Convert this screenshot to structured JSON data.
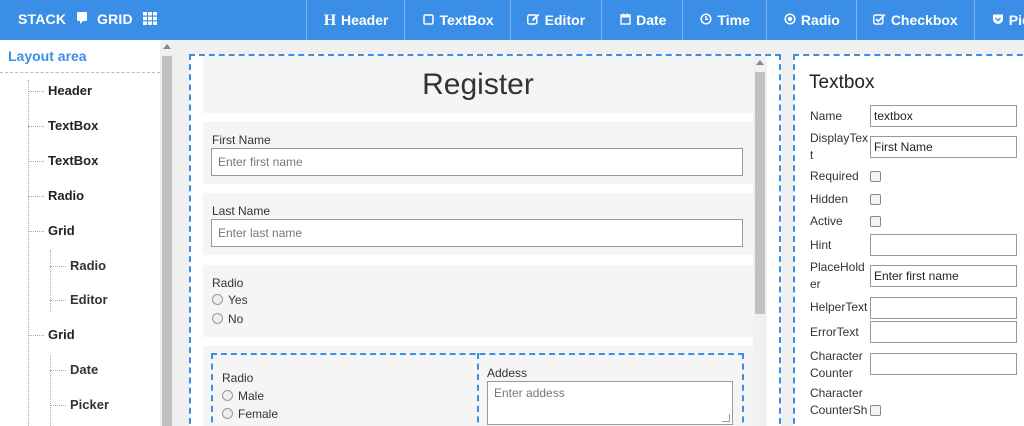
{
  "topbar": {
    "stack_label": "STACK",
    "grid_label": "GRID",
    "tabs": [
      {
        "label": "Header",
        "icon": "header-icon"
      },
      {
        "label": "TextBox",
        "icon": "square-icon"
      },
      {
        "label": "Editor",
        "icon": "edit-icon"
      },
      {
        "label": "Date",
        "icon": "calendar-icon"
      },
      {
        "label": "Time",
        "icon": "clock-icon"
      },
      {
        "label": "Radio",
        "icon": "radio-icon"
      },
      {
        "label": "Checkbox",
        "icon": "checkbox-icon"
      },
      {
        "label": "Picker",
        "icon": "picker-icon"
      }
    ],
    "color": "#3a8ee6"
  },
  "sidebar": {
    "title": "Layout area",
    "items": [
      {
        "label": "Header"
      },
      {
        "label": "TextBox"
      },
      {
        "label": "TextBox"
      },
      {
        "label": "Radio"
      },
      {
        "label": "Grid"
      },
      {
        "label": "Radio"
      },
      {
        "label": "Editor"
      },
      {
        "label": "Grid"
      },
      {
        "label": "Date"
      },
      {
        "label": "Picker"
      }
    ]
  },
  "form": {
    "title": "Register",
    "first_name": {
      "label": "First Name",
      "placeholder": "Enter first name"
    },
    "last_name": {
      "label": "Last Name",
      "placeholder": "Enter last name"
    },
    "radio": {
      "label": "Radio",
      "options": [
        "Yes",
        "No"
      ]
    },
    "grid": {
      "radio": {
        "label": "Radio",
        "options": [
          "Male",
          "Female"
        ]
      },
      "address": {
        "label": "Addess",
        "placeholder": "Enter addess"
      }
    }
  },
  "props": {
    "title": "Textbox",
    "fields": {
      "name": {
        "label": "Name",
        "value": "textbox"
      },
      "display_text": {
        "label": "DisplayText",
        "value": "First Name"
      },
      "required": {
        "label": "Required"
      },
      "hidden": {
        "label": "Hidden"
      },
      "active": {
        "label": "Active"
      },
      "hint": {
        "label": "Hint",
        "value": ""
      },
      "placeholder": {
        "label": "PlaceHolder",
        "value": "Enter first name"
      },
      "helper_text": {
        "label": "HelperText",
        "value": ""
      },
      "error_text": {
        "label": "ErrorText",
        "value": ""
      },
      "character_counter": {
        "label": "Character Counter",
        "value": ""
      },
      "character_counter_sh": {
        "label": "Character CounterSh"
      }
    }
  }
}
